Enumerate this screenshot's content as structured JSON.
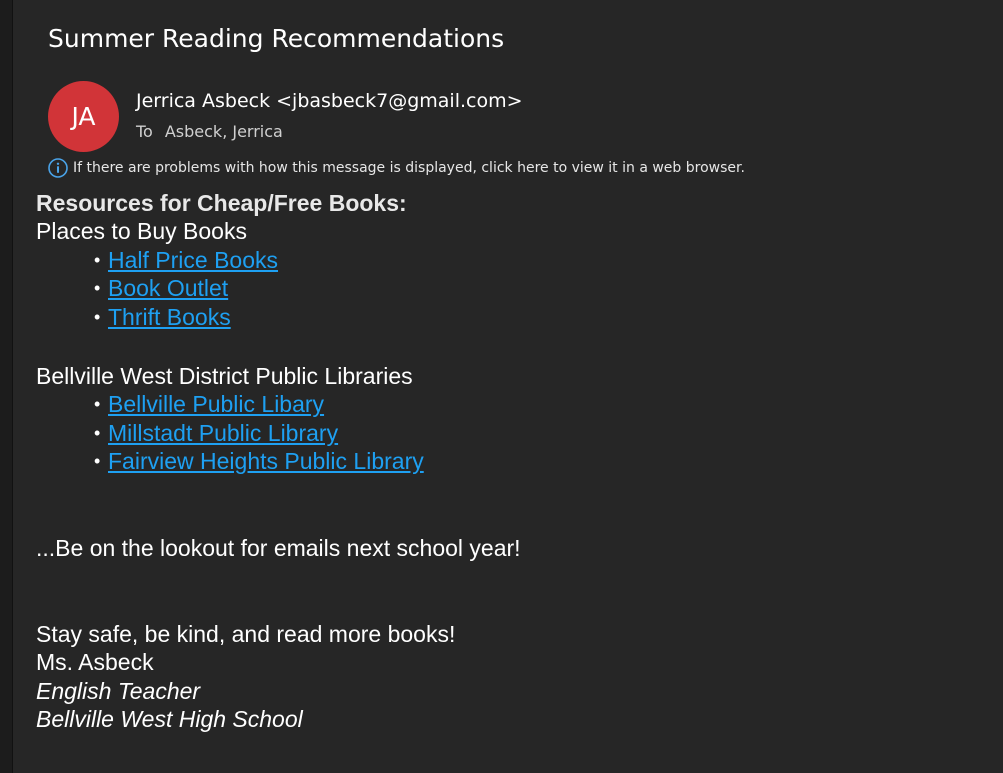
{
  "email": {
    "subject": "Summer Reading Recommendations",
    "avatar_initials": "JA",
    "avatar_color": "#d13438",
    "sender": "Jerrica Asbeck <jbasbeck7@gmail.com>",
    "to_label": "To",
    "to_recipient": "Asbeck, Jerrica",
    "info_icon": "info-icon",
    "info_text": "If there are problems with how this message is displayed, click here to view it in a web browser."
  },
  "body": {
    "heading": "Resources for Cheap/Free Books:",
    "section1_title": "Places to Buy Books",
    "section1_links": [
      "Half Price Books",
      "Book Outlet",
      "Thrift Books"
    ],
    "section2_title": "Bellville West District Public Libraries",
    "section2_links": [
      "Bellville Public Libary",
      "Millstadt Public Library",
      "Fairview Heights Public Library"
    ],
    "lookout": "...Be on the lookout for emails next school year!",
    "signoff": "Stay safe, be kind, and read more books!",
    "name": "Ms. Asbeck",
    "role": "English Teacher",
    "school": "Bellville West High School"
  },
  "colors": {
    "background": "#262626",
    "link": "#1ea0f2"
  }
}
